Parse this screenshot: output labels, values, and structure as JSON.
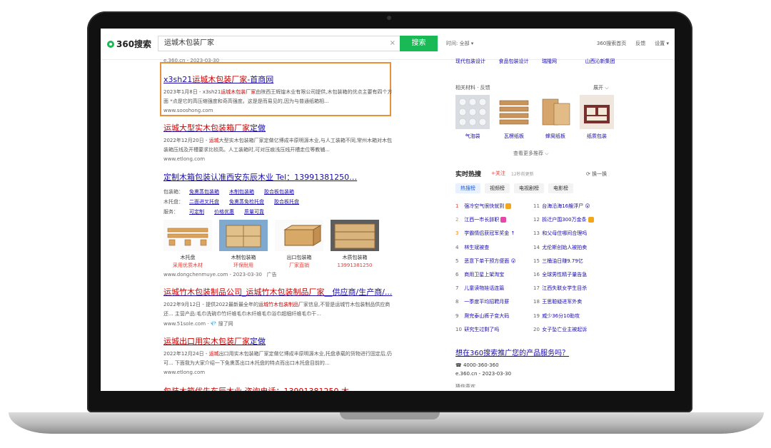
{
  "header": {
    "logo_text": "360搜索",
    "query": "运城木包装厂家",
    "search_button": "搜索",
    "clear": "×",
    "time_filter": "时间: 全部 ▾",
    "nav": [
      "360搜索首页",
      "反馈",
      "设置 ▾"
    ]
  },
  "colors": {
    "brand": "#19b955",
    "link": "#1a0dab",
    "highlight": "#cc0000",
    "outline": "#e8913a"
  },
  "meta_top": "e.360.cn - 2023-03-30",
  "results": [
    {
      "title_pre": "x3sh21",
      "title_hl": "运城木包装厂家",
      "title_post": "-首商网",
      "desc_pre": "2023年1月8日 - x3sh21",
      "desc_hl": "运城木包装厂家",
      "desc_post": "由陕西王辉煌木业有限公司提供,木包装箱的优点主要有四个方面 *点是它的高压缩强度和奇高强度。这是是而易见的,因为与普通纸箱相...",
      "url": "www.sooshong.com"
    },
    {
      "title_pre": "运城",
      "title_hl": "大型实木包装箱厂家",
      "title_post": "定做",
      "desc_pre": "2022年12月20日 - ",
      "desc_hl": "运城",
      "desc_post": "大型实木包装箱厂家定做亿博成丰原明源木业,与人工装箱不同,常州木箱对木包装箱压线及开槽要求比较高。人工装箱时,可对压痕浅压线开槽走位等教辅...",
      "url": "www.etlong.com"
    },
    {
      "title": "定制木箱包装认准西安东辰木业 Tel：13991381250…",
      "url": "www.dongchenmuye.com - 2023-03-30",
      "ad": "广告"
    },
    {
      "title_pre": "运城",
      "title_hl": "竹木包装制品公司_运城竹木包装制品厂家",
      "title_post": "__供应商/生产商/...",
      "desc_pre": "2022年9月12日 - 提供2022最新最全年的",
      "desc_hl": "运城竹木包装制品",
      "desc_post": "厂家信息,不管是运城竹木包装制品供应商还... 主营产品:毛巾洗碗巾竹纤维毛巾木纤维毛巾浴巾超细纤维毛巾干...",
      "url": "www.51sole.com · 💎 搜了网"
    },
    {
      "title_pre": "运城",
      "title_hl": "出口用实木包装厂家",
      "title_post": "定做",
      "desc_pre": "2022年12月24日 - ",
      "desc_hl": "运城",
      "desc_post": "出口用实木包装箱厂家定做亿博成丰原明源木业,托盘承载的货物进行固定后,仍可... 下面我为大家介绍一下免熏蒸出口木托盘的特点而出口木托盘目前的...",
      "url": "www.etlong.com"
    },
    {
      "title_partial": "包装木箱优先东辰木业 咨询电话：13991381250 木..."
    }
  ],
  "ad_block": {
    "rows": [
      {
        "label": "包装箱：",
        "links": [
          "免熏蒸包装箱",
          "木制包装箱",
          "胶合板包装箱"
        ]
      },
      {
        "label": "木托盘：",
        "links": [
          "二面进叉托盘",
          "免熏蒸免检托盘",
          "胶合板托盘"
        ]
      },
      {
        "label": "服务：",
        "links": [
          "可定制",
          "价格优惠",
          "质量可靠"
        ]
      }
    ],
    "products": [
      {
        "name": "木托盘",
        "sub": "采用优质木材"
      },
      {
        "name": "木制包装箱",
        "sub": "环保耐用"
      },
      {
        "name": "出口包装箱",
        "sub": "厂家直销"
      },
      {
        "name": "木质包装箱",
        "sub": "13991381250"
      }
    ]
  },
  "sidebar": {
    "related_links": [
      "现代包装设计",
      "食品包装设计",
      "瑞隆网",
      "山西沁新集团"
    ],
    "materials_title": "相关材料 · 反馈",
    "materials_expand": "展开 ⌵",
    "materials": [
      "气泡袋",
      "瓦楞纸板",
      "蜂窝纸板",
      "纸质包装"
    ],
    "more": "查看更多推荐 ⌵",
    "hot": {
      "title": "实时热搜",
      "follow": "+关注",
      "updated": "12秒前更新",
      "refresh": "⟳ 换一换",
      "tabs": [
        "热搜榜",
        "视频榜",
        "电视剧榜",
        "电影榜"
      ],
      "left": [
        {
          "n": "1",
          "t": "强冷空气很快就到",
          "badge": "hot"
        },
        {
          "n": "2",
          "t": "江西一市长辞职",
          "badge": "new"
        },
        {
          "n": "3",
          "t": "学霸情侣获冠军奖金 ↑",
          "badge": ""
        },
        {
          "n": "4",
          "t": "林生斌被查",
          "badge": ""
        },
        {
          "n": "5",
          "t": "恶意下单干预方便面 😮",
          "badge": ""
        },
        {
          "n": "6",
          "t": "商用卫星上架淘宝",
          "badge": ""
        },
        {
          "n": "7",
          "t": "儿童读物娃话连篇",
          "badge": ""
        },
        {
          "n": "8",
          "t": "一季度平均招聘月薪",
          "badge": ""
        },
        {
          "n": "9",
          "t": "爬完泰山裤子变大码",
          "badge": ""
        },
        {
          "n": "10",
          "t": "研究生过剩了吗",
          "badge": ""
        }
      ],
      "right": [
        {
          "n": "11",
          "t": "台海沿海16艘浮尸 😮",
          "badge": ""
        },
        {
          "n": "12",
          "t": "拆迁户围300万金条",
          "badge": "hot"
        },
        {
          "n": "13",
          "t": "和父母住哪间合理吗",
          "badge": ""
        },
        {
          "n": "14",
          "t": "尤伦斯创始人被拍卖",
          "badge": ""
        },
        {
          "n": "15",
          "t": "三桶油日赚9.79亿",
          "badge": ""
        },
        {
          "n": "16",
          "t": "全球男性精子量告急",
          "badge": ""
        },
        {
          "n": "17",
          "t": "江西失联女学生目杀",
          "badge": ""
        },
        {
          "n": "18",
          "t": "王思聪疑进军外卖",
          "badge": ""
        },
        {
          "n": "19",
          "t": "威少36分10助攻",
          "badge": ""
        },
        {
          "n": "20",
          "t": "女子坠亡业主被起诉",
          "badge": ""
        }
      ]
    },
    "promo": "想在360搜索推广您的产品服务吗？",
    "promo_phone": "☎ 4000-360-360",
    "promo_site": "e.360.cn - 2023-03-30",
    "promo_cut": "猜你喜欢"
  }
}
